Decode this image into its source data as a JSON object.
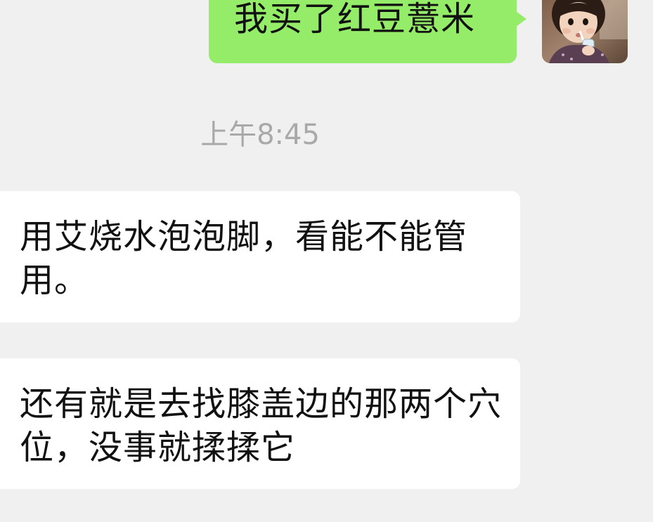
{
  "messages": [
    {
      "direction": "outgoing",
      "text": "我买了红豆薏米"
    },
    {
      "direction": "system",
      "text": "上午8:45"
    },
    {
      "direction": "incoming",
      "text": "用艾烧水泡泡脚，看能不能管用。"
    },
    {
      "direction": "incoming",
      "text": "还有就是去找膝盖边的那两个穴位，没事就揉揉它"
    }
  ],
  "colors": {
    "background": "#f0f0f0",
    "outgoing_bubble": "#95ec69",
    "incoming_bubble": "#ffffff",
    "timestamp_text": "#a9a9a9",
    "message_text": "#111111"
  },
  "icons": {
    "avatar": "user-avatar-photo"
  }
}
